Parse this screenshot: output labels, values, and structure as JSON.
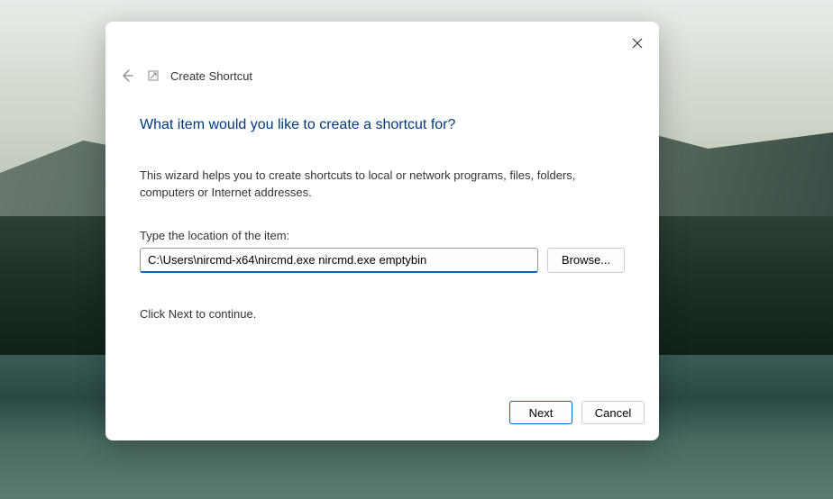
{
  "dialog": {
    "title": "Create Shortcut",
    "heading": "What item would you like to create a shortcut for?",
    "description": "This wizard helps you to create shortcuts to local or network programs, files, folders, computers or Internet addresses.",
    "input_label": "Type the location of the item:",
    "input_value": "C:\\Users\\nircmd-x64\\nircmd.exe nircmd.exe emptybin",
    "browse_label": "Browse...",
    "continue_text": "Click Next to continue.",
    "next_label": "Next",
    "cancel_label": "Cancel"
  }
}
